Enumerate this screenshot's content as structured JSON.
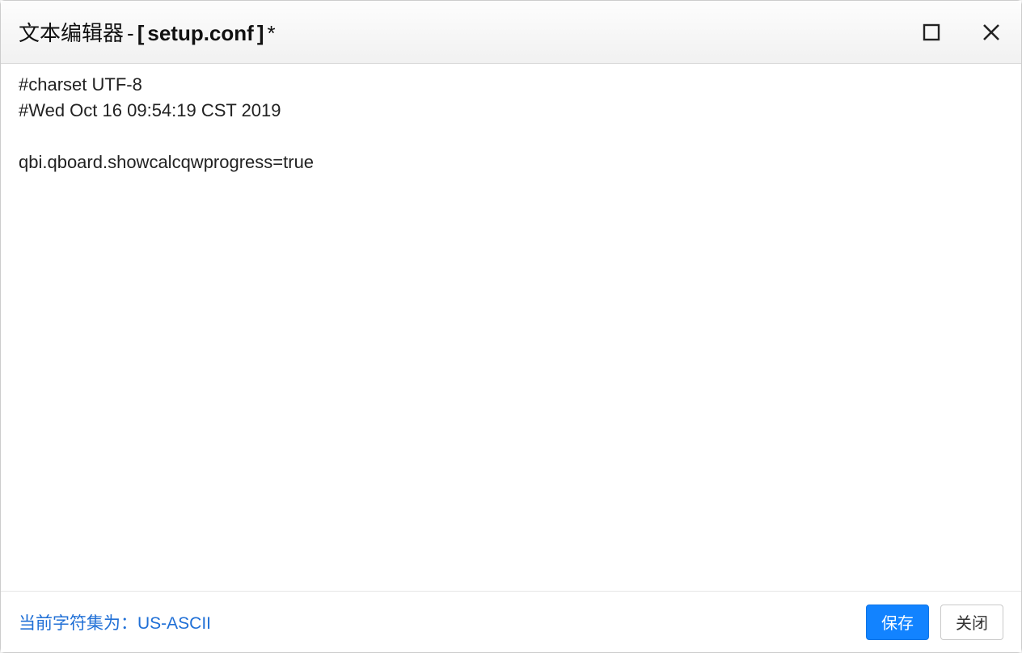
{
  "title": {
    "app_label": "文本编辑器",
    "separator": " - ",
    "bracket_open": "[",
    "file_name": "setup.conf",
    "bracket_close": "]",
    "dirty_mark": "*"
  },
  "editor": {
    "content": "#charset UTF-8\n#Wed Oct 16 09:54:19 CST 2019\n\nqbi.qboard.showcalcqwprogress=true"
  },
  "footer": {
    "charset_label": "当前字符集为：",
    "charset_value": "US-ASCII",
    "save_label": "保存",
    "close_label": "关闭"
  },
  "icons": {
    "maximize": "maximize-icon",
    "close": "close-icon"
  }
}
